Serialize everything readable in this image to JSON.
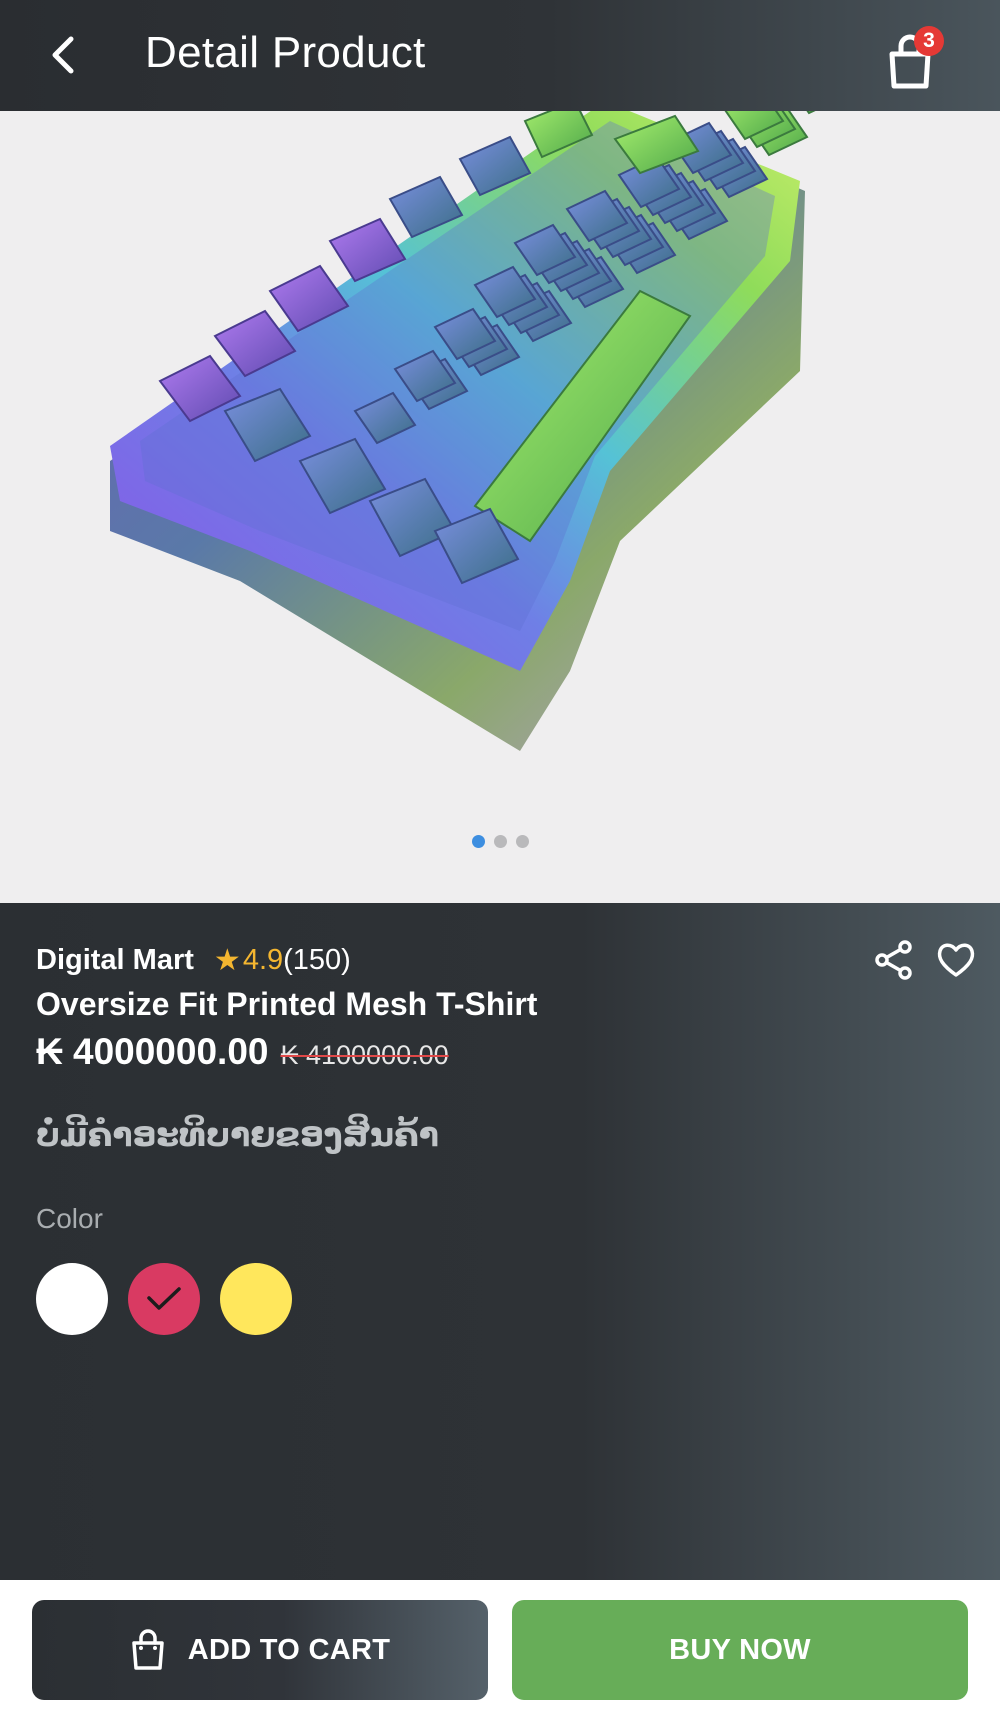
{
  "header": {
    "title": "Detail Product",
    "back_icon": "chevron-left-icon",
    "cart_icon": "shopping-bag-icon",
    "cart_count": "3"
  },
  "gallery": {
    "image_alt": "rainbow mechanical keyboard",
    "dots_total": 3,
    "active_index": 0
  },
  "product": {
    "store": "Digital Mart",
    "rating": "4.9",
    "reviews": "(150)",
    "title": "Oversize Fit Printed Mesh T-Shirt",
    "price": "₭ 4000000.00",
    "old_price": "₭ 4100000.00",
    "description": "ບໍ່ມີຄຳອະທິບາຍຂອງສິນຄ້າ",
    "share_icon": "share-icon",
    "favorite_icon": "heart-outline-icon"
  },
  "colors": {
    "label": "Color",
    "options": [
      {
        "name": "white",
        "hex": "#ffffff",
        "selected": false
      },
      {
        "name": "crimson",
        "hex": "#d93a62",
        "selected": true
      },
      {
        "name": "yellow",
        "hex": "#ffe75c",
        "selected": false
      }
    ]
  },
  "actions": {
    "add_to_cart": "ADD TO CART",
    "buy_now": "BUY NOW"
  },
  "theme": {
    "accent_green": "#67ad58",
    "badge_red": "#e53935",
    "star": "#f4b630",
    "dot_active": "#3d8ee0"
  }
}
